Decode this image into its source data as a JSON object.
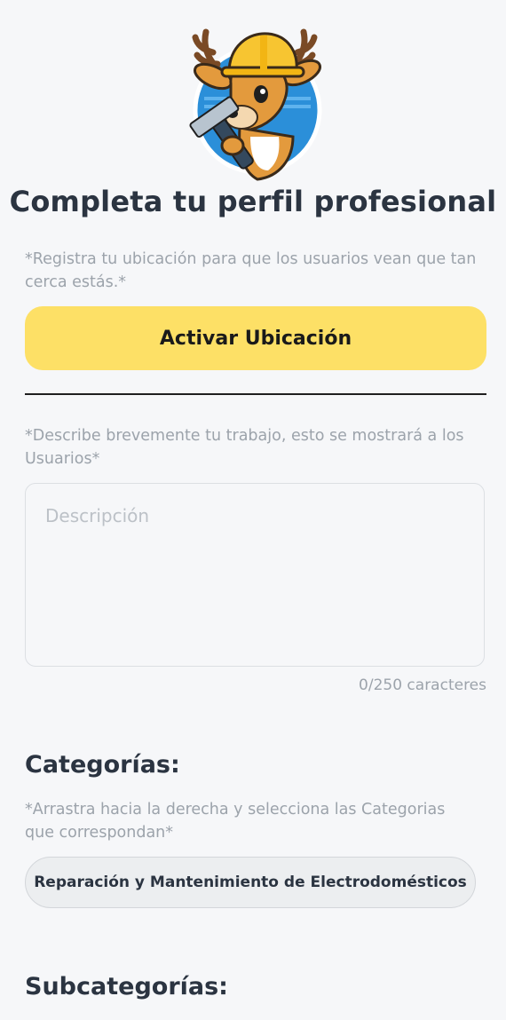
{
  "header": {
    "logo_icon": "deer-construction-worker-icon",
    "title": "Completa tu perfil profesional"
  },
  "location": {
    "hint": "*Registra tu ubicación para que los usuarios vean que tan cerca estás.*",
    "button_label": "Activar Ubicación",
    "button_color": "#fde066"
  },
  "description": {
    "hint": "*Describe brevemente tu trabajo, esto se mostrará a los Usuarios*",
    "placeholder": "Descripción",
    "value": "",
    "counter": "0/250 caracteres"
  },
  "categories": {
    "title": "Categorías:",
    "hint": "*Arrastra hacia la derecha y selecciona las Categorias que correspondan*",
    "items": [
      {
        "label": "Reparación y Mantenimiento de Electrodomésticos"
      }
    ]
  },
  "subcategories": {
    "title": "Subcategorías:"
  },
  "colors": {
    "background": "#f6f7f9",
    "title_text": "#2b3441",
    "hint_text": "#9ca3ab"
  }
}
